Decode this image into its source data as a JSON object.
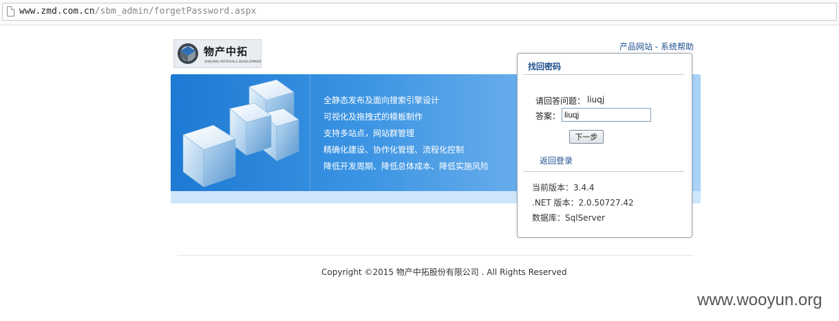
{
  "browser": {
    "url_host": "www.zmd.com.cn",
    "url_path": "/sbm_admin/forgetPassword.aspx"
  },
  "logo": {
    "name_cn": "物产中拓",
    "name_en": "ZHEJIANG MATERIALS DEVELOPMENT"
  },
  "top_links": {
    "product_site": "产品网站",
    "separator": " - ",
    "system_help": "系统帮助"
  },
  "banner": {
    "features": [
      "全静态发布及面向搜索引擎设计",
      "可视化及拖拽式的模板制作",
      "支持多站点，网站群管理",
      "精确化建设、协作化管理、流程化控制",
      "降低开发周期、降低总体成本、降低实施风险"
    ]
  },
  "panel": {
    "title": "找回密码",
    "question_label": "请回答问题：",
    "question_value": "liuqj",
    "answer_label": "答案：",
    "answer_value": "liuqj",
    "next_button": "下一步",
    "back_link": "返回登录",
    "version_line": "当前版本：3.4.4",
    "net_version_line": ".NET 版本：2.0.50727.42",
    "database_line": "数据库：SqlServer"
  },
  "footer": {
    "copyright": "Copyright ©2015 物产中拓股份有限公司 . All Rights Reserved"
  },
  "watermark": "www.wooyun.org",
  "colors": {
    "link_blue": "#1e4f8e",
    "banner_blue": "#2a86da"
  },
  "icons": {
    "page": "page-icon",
    "logo": "logo-mark-icon",
    "banner": "cubes-illustration"
  }
}
